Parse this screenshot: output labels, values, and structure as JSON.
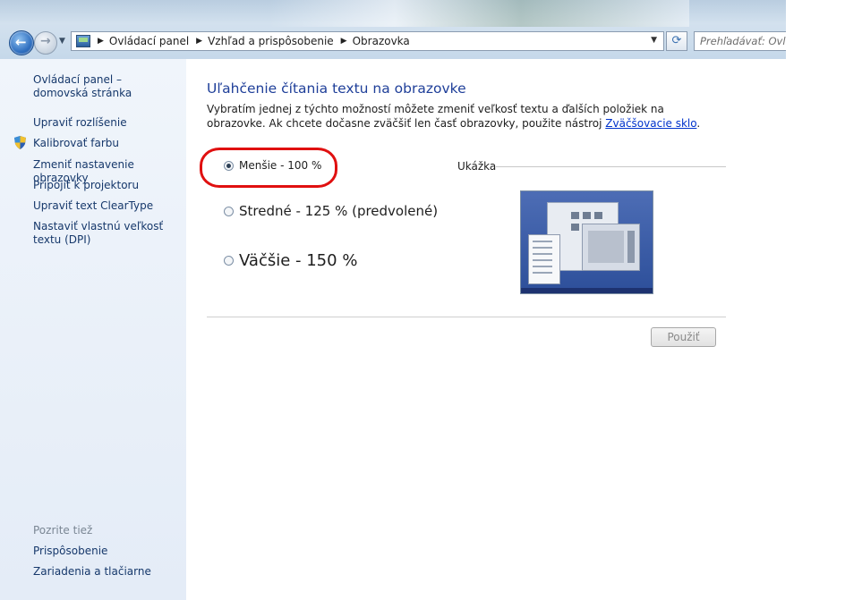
{
  "address_bar": {
    "crumbs": [
      "Ovládací panel",
      "Vzhľad a prispôsobenie",
      "Obrazovka"
    ],
    "search_placeholder": "Prehľadávať: Ovlá"
  },
  "sidebar": {
    "home_link": "Ovládací panel – domovská stránka",
    "tasks": [
      "Upraviť rozlíšenie",
      "Kalibrovať farbu",
      "Zmeniť nastavenie obrazovky",
      "Pripojiť k projektoru",
      "Upraviť text ClearType",
      "Nastaviť vlastnú veľkosť textu (DPI)"
    ],
    "see_also_title": "Pozrite tiež",
    "see_also": [
      "Prispôsobenie",
      "Zariadenia a tlačiarne"
    ]
  },
  "main": {
    "heading": "Uľahčenie čítania textu na obrazovke",
    "description": "Vybratím jednej z týchto možností môžete zmeniť veľkosť textu a ďalších položiek na obrazovke. Ak chcete dočasne zväčšiť len časť obrazovky, použite nástroj ",
    "magnifier_link": "Zväčšovacie sklo",
    "description_end": ".",
    "options": [
      {
        "label": "Menšie - 100 %",
        "selected": true
      },
      {
        "label": "Stredné - 125 % (predvolené)",
        "selected": false
      },
      {
        "label": "Väčšie - 150 %",
        "selected": false
      }
    ],
    "preview_label": "Ukážka",
    "apply_button": "Použiť"
  },
  "colors": {
    "heading": "#1f3f99",
    "link": "#16386b",
    "annotation_ring": "#e01010"
  }
}
